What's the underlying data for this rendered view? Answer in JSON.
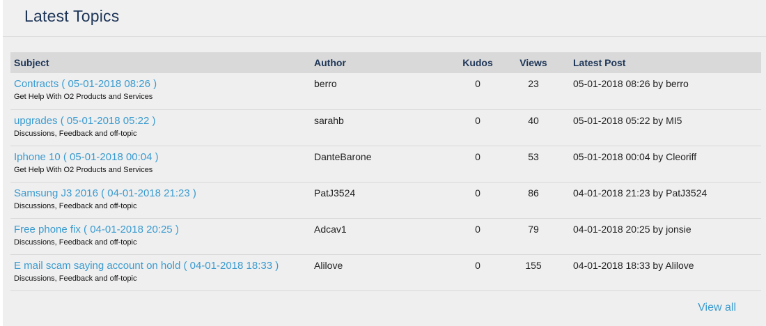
{
  "panel": {
    "title": "Latest Topics",
    "view_all_label": "View all"
  },
  "table": {
    "headers": {
      "subject": "Subject",
      "author": "Author",
      "kudos": "Kudos",
      "views": "Views",
      "latest_post": "Latest Post"
    },
    "rows": [
      {
        "subject": "Contracts ( 05-01-2018 08:26 )",
        "board": "Get Help With O2 Products and Services",
        "author": "berro",
        "kudos": "0",
        "views": "23",
        "latest_post": "05-01-2018 08:26 by berro"
      },
      {
        "subject": "upgrades ( 05-01-2018 05:22 )",
        "board": "Discussions, Feedback and off-topic",
        "author": "sarahb",
        "kudos": "0",
        "views": "40",
        "latest_post": "05-01-2018 05:22 by MI5"
      },
      {
        "subject": "Iphone 10 ( 05-01-2018 00:04 )",
        "board": "Get Help With O2 Products and Services",
        "author": "DanteBarone",
        "kudos": "0",
        "views": "53",
        "latest_post": "05-01-2018 00:04 by Cleoriff"
      },
      {
        "subject": "Samsung J3 2016 ( 04-01-2018 21:23 )",
        "board": "Discussions, Feedback and off-topic",
        "author": "PatJ3524",
        "kudos": "0",
        "views": "86",
        "latest_post": "04-01-2018 21:23 by PatJ3524"
      },
      {
        "subject": "Free phone fix ( 04-01-2018 20:25 )",
        "board": "Discussions, Feedback and off-topic",
        "author": "Adcav1",
        "kudos": "0",
        "views": "79",
        "latest_post": "04-01-2018 20:25 by jonsie"
      },
      {
        "subject": "E mail scam saying account on hold ( 04-01-2018 18:33 )",
        "board": "Discussions, Feedback and off-topic",
        "author": "Alilove",
        "kudos": "0",
        "views": "155",
        "latest_post": "04-01-2018 18:33 by Alilove"
      }
    ]
  },
  "colors": {
    "link": "#3a9bd0",
    "title": "#1d3557",
    "header_bg": "#d9d9d9",
    "panel_bg": "#efefef"
  }
}
